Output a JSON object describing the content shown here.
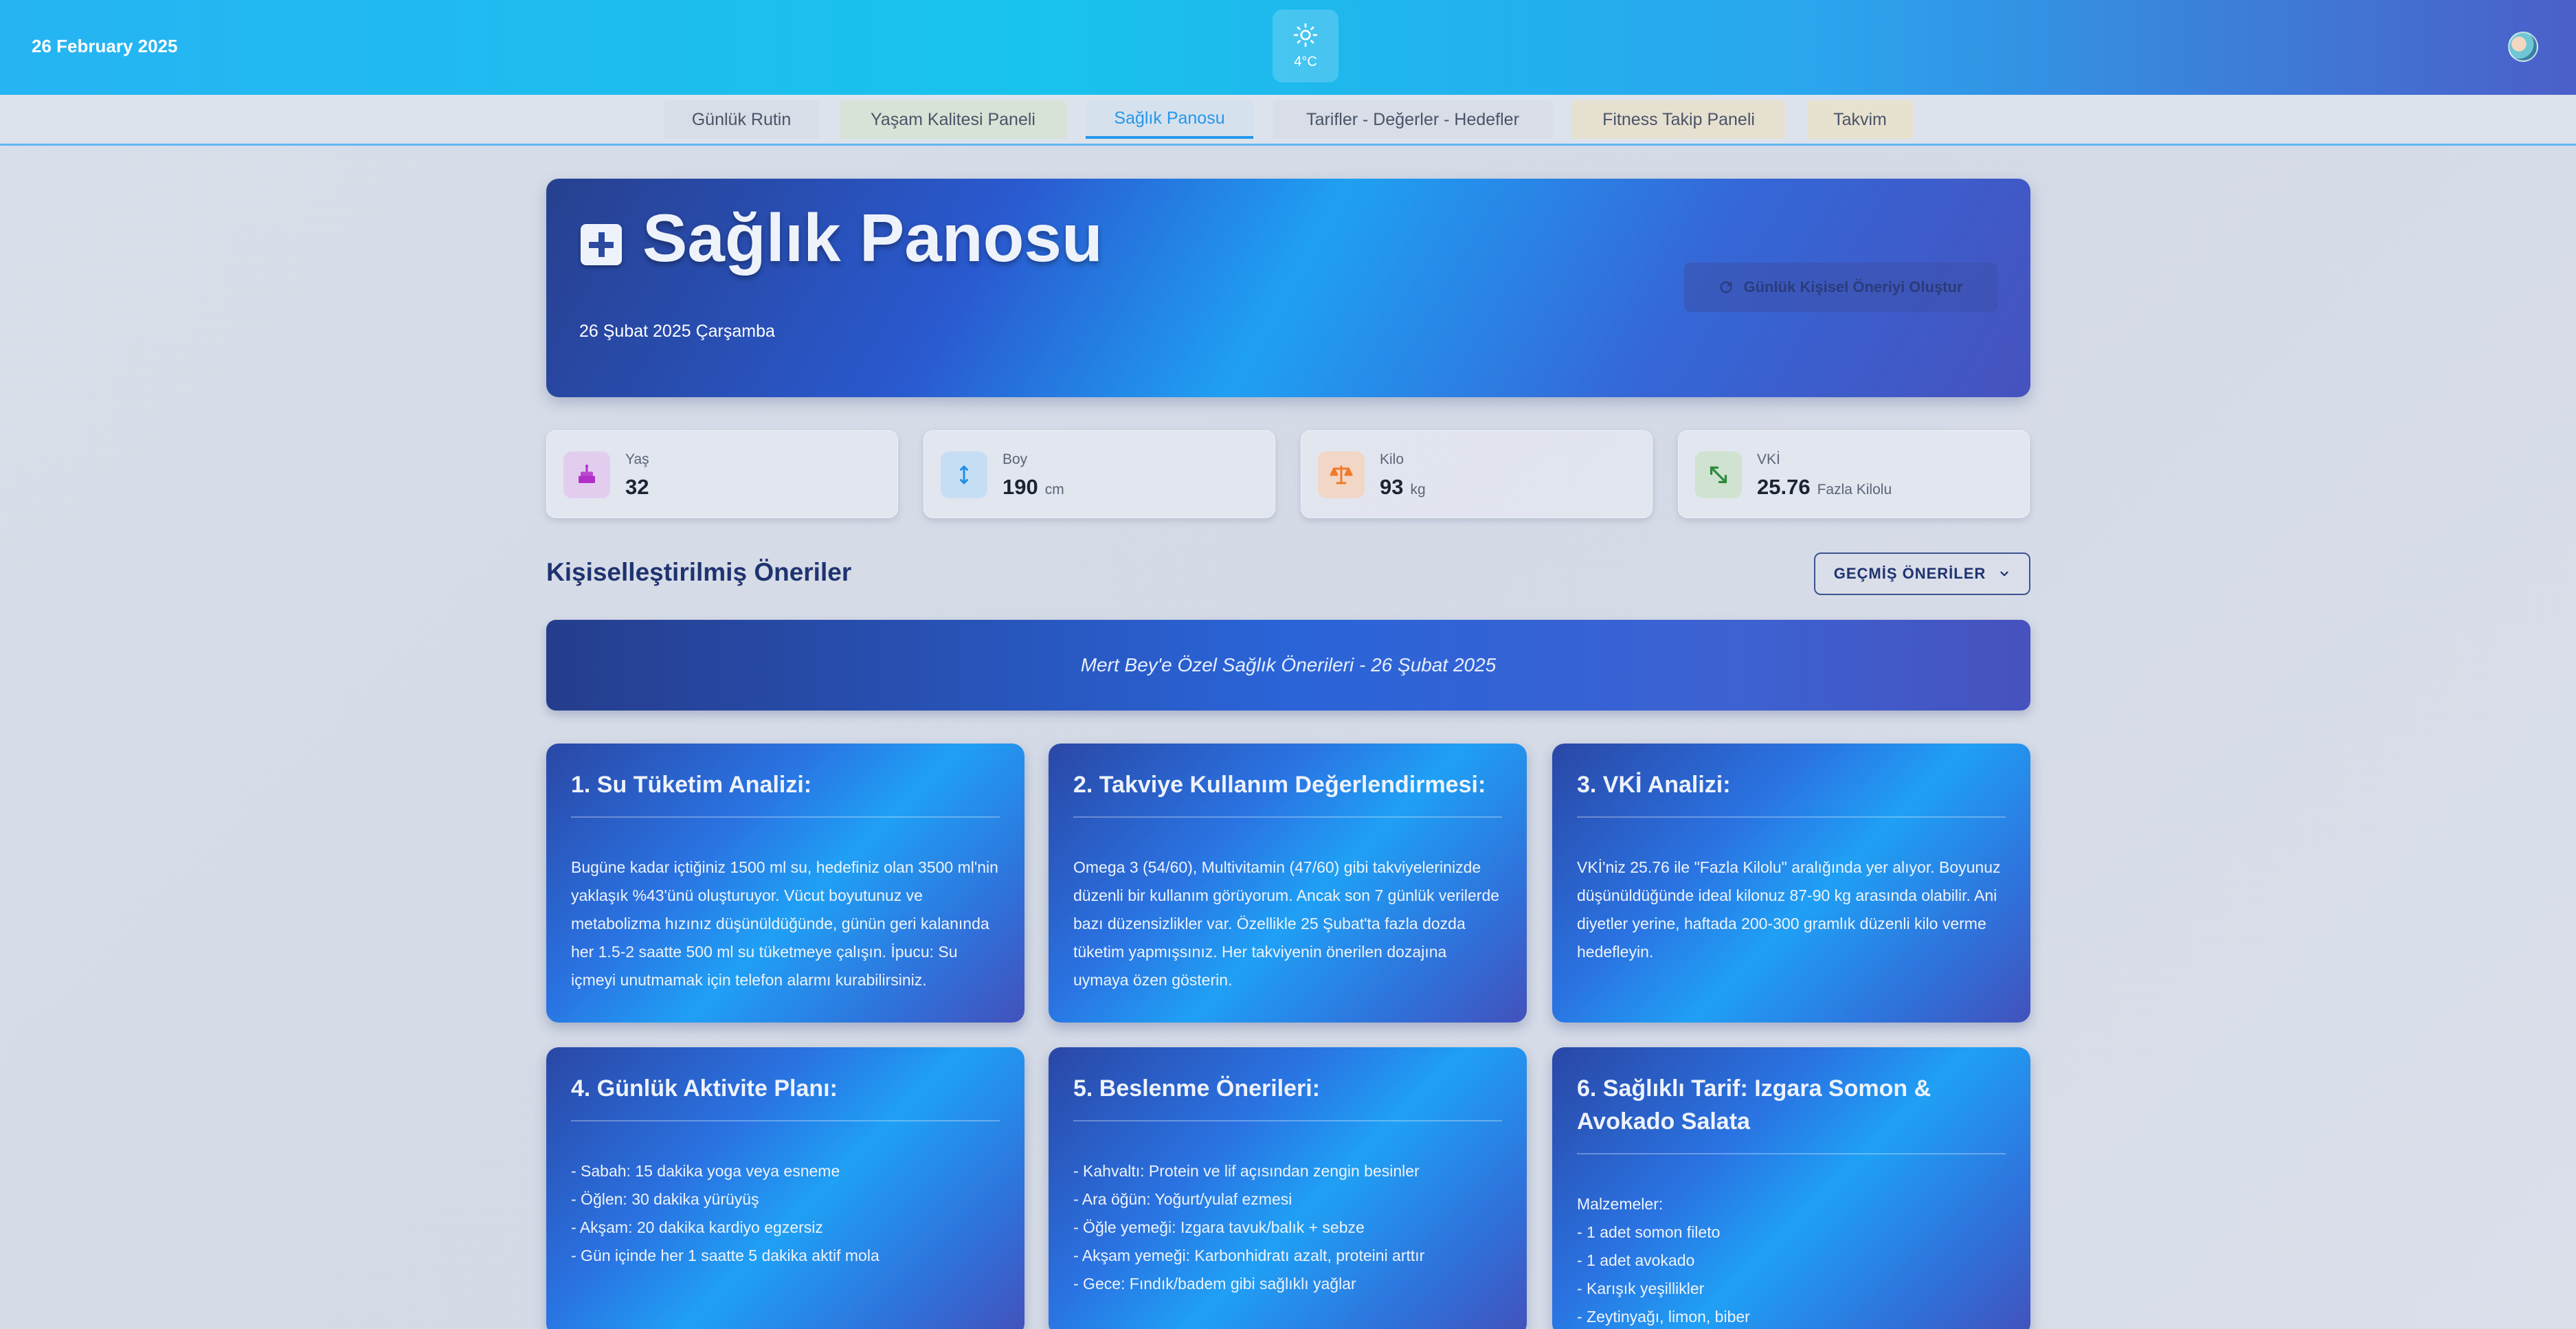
{
  "header": {
    "date": "26 February 2025",
    "weather_temp": "4°C",
    "weather_icon": "sun-icon"
  },
  "tabs": [
    {
      "label": "Günlük Rutin"
    },
    {
      "label": "Yaşam Kalitesi Paneli"
    },
    {
      "label": "Sağlık Panosu",
      "active": true
    },
    {
      "label": "Tarifler - Değerler - Hedefler"
    },
    {
      "label": "Fitness Takip Paneli"
    },
    {
      "label": "Takvim"
    }
  ],
  "hero": {
    "title": "Sağlık Panosu",
    "subdate": "26 Şubat 2025 Çarşamba",
    "generate_button": "Günlük Kişisel Öneriyi Oluştur"
  },
  "stats": [
    {
      "label": "Yaş",
      "value": "32",
      "unit": "",
      "icon": "cake-icon",
      "color": "#b030c8"
    },
    {
      "label": "Boy",
      "value": "190",
      "unit": "cm",
      "icon": "height-icon",
      "color": "#1f8fe6"
    },
    {
      "label": "Kilo",
      "value": "93",
      "unit": "kg",
      "icon": "scale-icon",
      "color": "#f07a2a"
    },
    {
      "label": "VKİ",
      "value": "25.76",
      "unit": "Fazla Kilolu",
      "icon": "expand-icon",
      "color": "#2e8a3c"
    }
  ],
  "recommendations": {
    "section_title": "Kişiselleştirilmiş Öneriler",
    "history_button": "GEÇMİŞ ÖNERİLER",
    "banner": "Mert Bey'e Özel Sağlık Önerileri - 26 Şubat 2025",
    "cards": [
      {
        "title": "1. Su Tüketim Analizi:",
        "body": "Bugüne kadar içtiğiniz 1500 ml su, hedefiniz olan 3500 ml'nin yaklaşık %43'ünü oluşturuyor. Vücut boyutunuz ve metabolizma hızınız düşünüldüğünde, günün geri kalanında her 1.5-2 saatte 500 ml su tüketmeye çalışın. İpucu: Su içmeyi unutmamak için telefon alarmı kurabilirsiniz."
      },
      {
        "title": "2. Takviye Kullanım Değerlendirmesi:",
        "body": "Omega 3 (54/60), Multivitamin (47/60) gibi takviyelerinizde düzenli bir kullanım görüyorum. Ancak son 7 günlük verilerde bazı düzensizlikler var. Özellikle 25 Şubat'ta fazla dozda tüketim yapmışsınız. Her takviyenin önerilen dozajına uymaya özen gösterin."
      },
      {
        "title": "3. VKİ Analizi:",
        "body": "VKİ'niz 25.76 ile \"Fazla Kilolu\" aralığında yer alıyor. Boyunuz düşünüldüğünde ideal kilonuz 87-90 kg arasında olabilir. Ani diyetler yerine, haftada 200-300 gramlık düzenli kilo verme hedefleyin."
      },
      {
        "title": "4. Günlük Aktivite Planı:",
        "body": "- Sabah: 15 dakika yoga veya esneme\n- Öğlen: 30 dakika yürüyüş\n- Akşam: 20 dakika kardiyo egzersiz\n- Gün içinde her 1 saatte 5 dakika aktif mola"
      },
      {
        "title": "5. Beslenme Önerileri:",
        "body": "- Kahvaltı: Protein ve lif açısından zengin besinler\n- Ara öğün: Yoğurt/yulaf ezmesi\n- Öğle yemeği: Izgara tavuk/balık + sebze\n- Akşam yemeği: Karbonhidratı azalt, proteini arttır\n- Gece: Fındık/badem gibi sağlıklı yağlar"
      },
      {
        "title": "6. Sağlıklı Tarif: Izgara Somon & Avokado Salata",
        "body": "Malzemeler:\n- 1 adet somon fileto\n- 1 adet avokado\n- Karışık yeşillikler\n- Zeytinyağı, limon, biber"
      }
    ]
  }
}
